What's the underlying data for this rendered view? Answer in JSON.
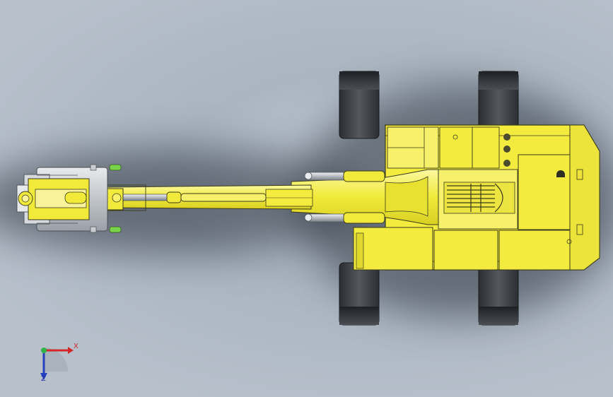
{
  "viewport": {
    "view": "top",
    "background": "#b4bec9"
  },
  "model": {
    "body_color": "#f2ec3c",
    "body_highlight": "#fbf77a",
    "track_color": "#3a3d42",
    "hydraulic_color": "#c9ccd1",
    "cap_color": "#7cd14a"
  },
  "triad": {
    "x_label": "X",
    "z_label": "Z",
    "x_color": "#d22a2a",
    "y_color": "#2fb34a",
    "z_color": "#2640c0"
  }
}
